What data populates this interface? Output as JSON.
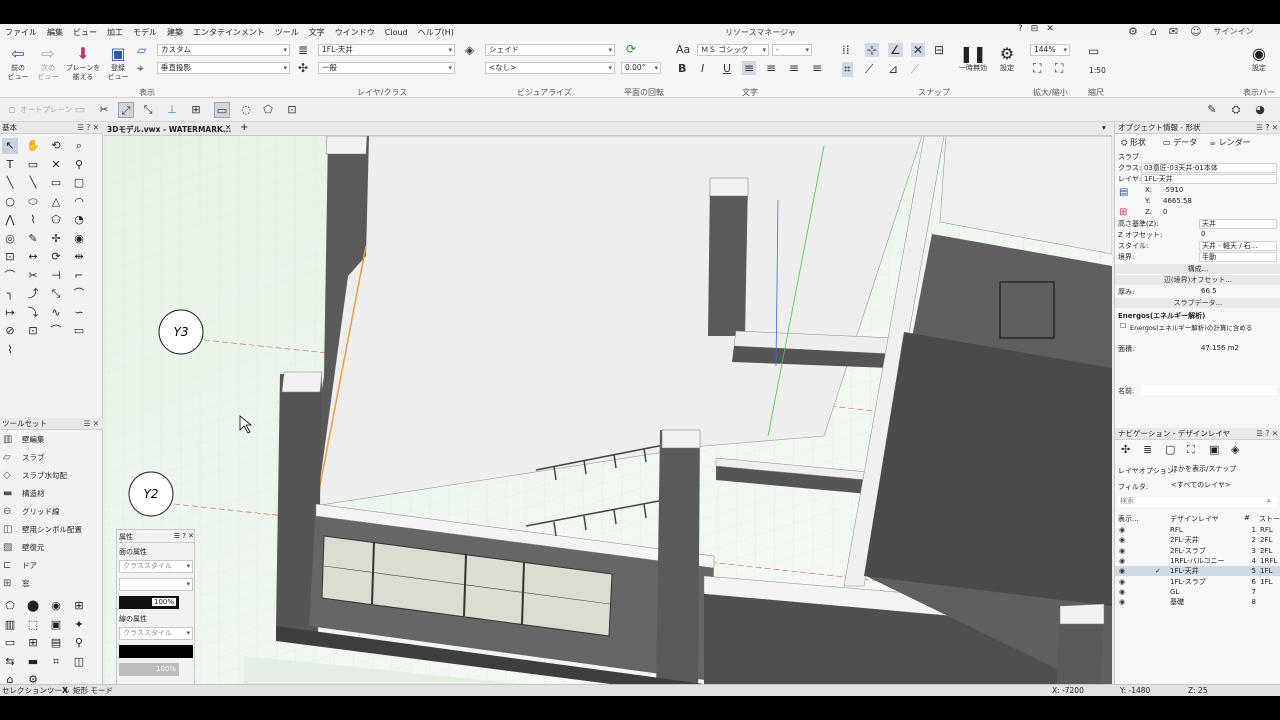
{
  "menubar": {
    "items": [
      "ファイル",
      "編集",
      "ビュー",
      "加工",
      "モデル",
      "建築",
      "エンタテインメント",
      "ツール",
      "文字",
      "ウインドウ",
      "Cloud",
      "ヘルプ(H)"
    ],
    "resource_manager": "リソースマネージャ",
    "signin": "サインイン"
  },
  "ribbon": {
    "prev_view": "前の\nビュー",
    "next_view": "次の\nビュー",
    "align_planes": "プレーンを\n揃える",
    "register_view": "登録\nビュー",
    "plane_dd": "カスタム",
    "projection_dd": "垂直投影",
    "layer_dd": "1FL-天井",
    "class_dd": "一般",
    "render_dd": "シェイド",
    "visualize_dd": "<なし>",
    "rotation_value": "0.00°",
    "font_dd": "ＭＳ ゴシック",
    "font_size_dd": "-",
    "pause_label": "一時無効",
    "settings_label": "設定",
    "zoom_value": "144%",
    "scale_value": "1:50",
    "settings_right": "設定",
    "group_labels": [
      "表示",
      "レイヤ/クラス",
      "ビジュアライズ",
      "平面の回転",
      "文字",
      "スナップ",
      "拡大/縮小",
      "縮尺",
      "表示バー"
    ],
    "text_buttons": [
      "B",
      "I",
      "U"
    ]
  },
  "toolbar2": {
    "auto_plane": "オートプレーン"
  },
  "tool_palette": {
    "title": "基本",
    "toolset_title": "ツールセット",
    "toolsets": [
      "壁編集",
      "スラブ",
      "スラブ水勾配",
      "構造材",
      "グリッド線",
      "壁用シンボル配置",
      "壁復元",
      "ドア",
      "窓"
    ]
  },
  "document": {
    "tab_title": "3Dモデル.vwx - WATERMARK...",
    "add_tab": "+",
    "grid_labels": [
      "Y3",
      "Y2"
    ]
  },
  "attributes": {
    "title": "属性",
    "fill_label": "面の属性",
    "class_style": "クラススタイル",
    "fill_opacity": "100%",
    "line_label": "線の属性",
    "class_style_line": "クラススタイル",
    "line_opacity": "100%"
  },
  "object_info": {
    "title": "オブジェクト情報 - 形状",
    "tabs": [
      "形状",
      "データ",
      "レンダー"
    ],
    "object_type": "スラブ",
    "class_label": "クラス:",
    "class_value": "03意匠-03天井-01本体",
    "layer_label": "レイヤ:",
    "layer_value": "1FL-天井",
    "x_label": "X:",
    "x_value": "-5910",
    "y_label": "Y:",
    "y_value": "4665.58",
    "z_label": "Z:",
    "z_value": "0",
    "height_ref_label": "高さ基準(Z):",
    "height_ref_value": "天井",
    "z_offset_label": "Z オフセット:",
    "z_offset_value": "0",
    "style_label": "スタイル:",
    "style_value": "天井 - 軽天 / 石...",
    "boundary_label": "境界:",
    "boundary_value": "手動",
    "composition_btn": "構成...",
    "edge_offset_btn": "辺(境界)オフセット...",
    "thickness_label": "厚み:",
    "thickness_value": "66.5",
    "slab_data_btn": "スラブデータ...",
    "energos_title": "Energos(エネルギー解析)",
    "energos_check": "Energos(エネルギー解析)の計算に含める",
    "area_label": "面積:",
    "area_value": "47.156 m2",
    "name_label": "名前:"
  },
  "navigation": {
    "title": "ナビゲーション - デザインレイヤ",
    "layer_options_label": "レイヤオプション:",
    "layer_options_value": "ほかを表示/スナップ",
    "filter_label": "フィルタ:",
    "filter_value": "<すべてのレイヤ>",
    "search_placeholder": "検索",
    "col_visibility": "表示...",
    "col_design_layer": "デザインレイヤ",
    "col_number": "#",
    "col_story": "ストーリ",
    "layers": [
      {
        "name": "RFL",
        "num": "1",
        "story": "RFL"
      },
      {
        "name": "2FL-天井",
        "num": "2",
        "story": "2FL"
      },
      {
        "name": "2FL-スラブ",
        "num": "3",
        "story": "2FL"
      },
      {
        "name": "1RFL-バルコニー",
        "num": "4",
        "story": "1RFL"
      },
      {
        "name": "1FL-天井",
        "num": "5",
        "story": "1FL"
      },
      {
        "name": "1FL-スラブ",
        "num": "6",
        "story": "1FL"
      },
      {
        "name": "GL",
        "num": "7",
        "story": ""
      },
      {
        "name": "基礎",
        "num": "8",
        "story": ""
      }
    ],
    "active_layer_index": 4
  },
  "status": {
    "tool": "セレクションツール",
    "mode_sep": "X",
    "mode": "矩形 モード",
    "x": "X: -7200",
    "y": "Y: -1480",
    "z": "Z: 25"
  },
  "colors": {
    "accent": "#2a5a9c",
    "selection": "#cfd8e6",
    "grid": "#cfe8cf",
    "wall": "#4a4a4a"
  }
}
